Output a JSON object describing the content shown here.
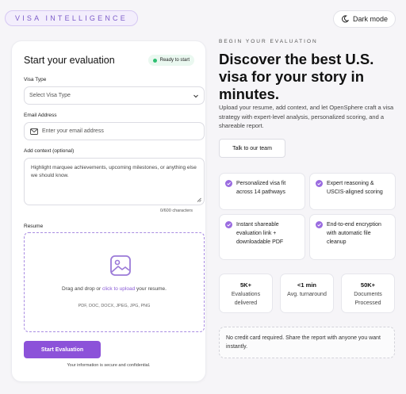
{
  "header": {
    "brand": "VISA INTELLIGENCE",
    "dark_mode_label": "Dark mode"
  },
  "form": {
    "title": "Start your evaluation",
    "status": "Ready to start",
    "visa_type": {
      "label": "Visa Type",
      "value": "Select Visa Type"
    },
    "email": {
      "label": "Email Address",
      "placeholder": "Enter your email address"
    },
    "context": {
      "label": "Add context (optional)",
      "placeholder": "Highlight marquee achievements, upcoming milestones, or anything else we should know.",
      "char_count": "0/600 characters"
    },
    "resume": {
      "label": "Resume",
      "drop_prefix": "Drag and drop or ",
      "drop_link": "click to upload",
      "drop_suffix": " your resume.",
      "formats": "PDF, DOC, DOCX, JPEG, JPG, PNG"
    },
    "submit_label": "Start Evaluation",
    "secure_note": "Your information is secure and confidential."
  },
  "hero": {
    "eyebrow": "BEGIN YOUR EVALUATION",
    "headline": "Discover the best U.S. visa for your story in minutes.",
    "lead": "Upload your resume, add context, and let OpenSphere craft a visa strategy with expert-level analysis, personalized scoring, and a shareable report.",
    "cta_label": "Talk to our team"
  },
  "features": [
    "Personalized visa fit across 14 pathways",
    "Expert reasoning & USCIS-aligned scoring",
    "Instant shareable evaluation link + downloadable PDF",
    "End-to-end encryption with automatic file cleanup"
  ],
  "stats": [
    {
      "value": "5K+",
      "label": "Evaluations delivered"
    },
    {
      "value": "<1 min",
      "label": "Avg. turnaround"
    },
    {
      "value": "50K+",
      "label": "Documents Processed"
    }
  ],
  "note": "No credit card required. Share the report with anyone you want instantly.",
  "colors": {
    "accent": "#8c52d9",
    "status_green": "#2fbf71",
    "background": "#f6f5f8"
  },
  "icons": {
    "theme_toggle": "moon-icon",
    "select": "chevron-down-icon",
    "email": "mail-icon",
    "upload": "image-icon",
    "feature": "check-circle-icon"
  }
}
